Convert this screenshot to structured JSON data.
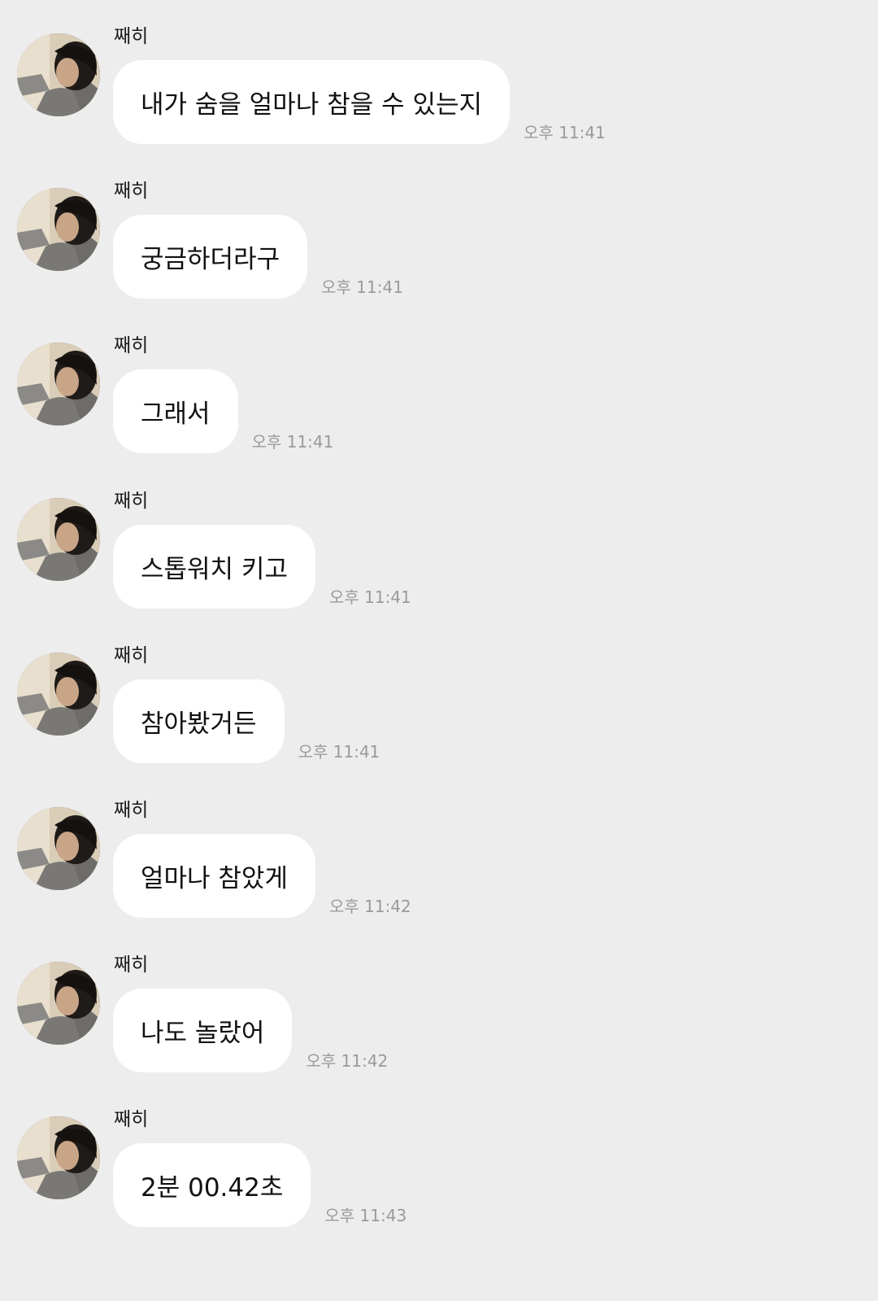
{
  "messages": [
    {
      "sender": "째히",
      "text": "내가 숨을 얼마나 참을 수 있는지",
      "time": "오후 11:41"
    },
    {
      "sender": "째히",
      "text": "궁금하더라구",
      "time": "오후 11:41"
    },
    {
      "sender": "째히",
      "text": "그래서",
      "time": "오후 11:41"
    },
    {
      "sender": "째히",
      "text": "스톱워치 키고",
      "time": "오후 11:41"
    },
    {
      "sender": "째히",
      "text": "참아봤거든",
      "time": "오후 11:41"
    },
    {
      "sender": "째히",
      "text": "얼마나 참았게",
      "time": "오후 11:42"
    },
    {
      "sender": "째히",
      "text": "나도 놀랐어",
      "time": "오후 11:42"
    },
    {
      "sender": "째히",
      "text": "2분 00.42초",
      "time": "오후 11:43"
    }
  ],
  "colors": {
    "background": "#ededed",
    "bubble": "#ffffff",
    "timestamp": "#9a9a9a"
  },
  "icons": {
    "avatar": "profile-photo"
  }
}
